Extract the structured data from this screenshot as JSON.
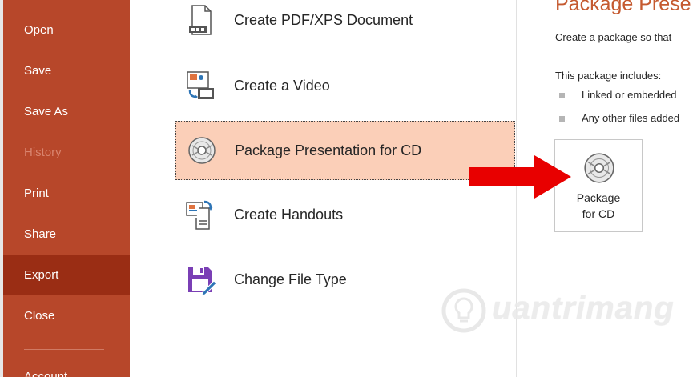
{
  "sidebar": {
    "items": [
      {
        "label": "Open",
        "state": "normal"
      },
      {
        "label": "Save",
        "state": "normal"
      },
      {
        "label": "Save As",
        "state": "normal"
      },
      {
        "label": "History",
        "state": "disabled"
      },
      {
        "label": "Print",
        "state": "normal"
      },
      {
        "label": "Share",
        "state": "normal"
      },
      {
        "label": "Export",
        "state": "active"
      },
      {
        "label": "Close",
        "state": "normal"
      }
    ],
    "cut_label": "Account"
  },
  "export_options": [
    {
      "label": "Create PDF/XPS Document",
      "icon": "pdf-document-icon"
    },
    {
      "label": "Create a Video",
      "icon": "video-icon"
    },
    {
      "label": "Package Presentation for CD",
      "icon": "cd-icon",
      "selected": true
    },
    {
      "label": "Create Handouts",
      "icon": "handouts-icon"
    },
    {
      "label": "Change File Type",
      "icon": "save-file-type-icon"
    }
  ],
  "detail": {
    "title": "Package Prese",
    "description": "Create a package so that",
    "includes_heading": "This package includes:",
    "bullets": [
      "Linked or embedded",
      "Any other files added"
    ],
    "button_line1": "Package",
    "button_line2": "for CD"
  },
  "watermark": {
    "text": "uantrimang"
  },
  "colors": {
    "sidebar_bg": "#b7472a",
    "sidebar_active": "#9a2d14",
    "selected_bg": "#fbcfb8",
    "title_color": "#c55a30",
    "arrow_red": "#e80000"
  }
}
